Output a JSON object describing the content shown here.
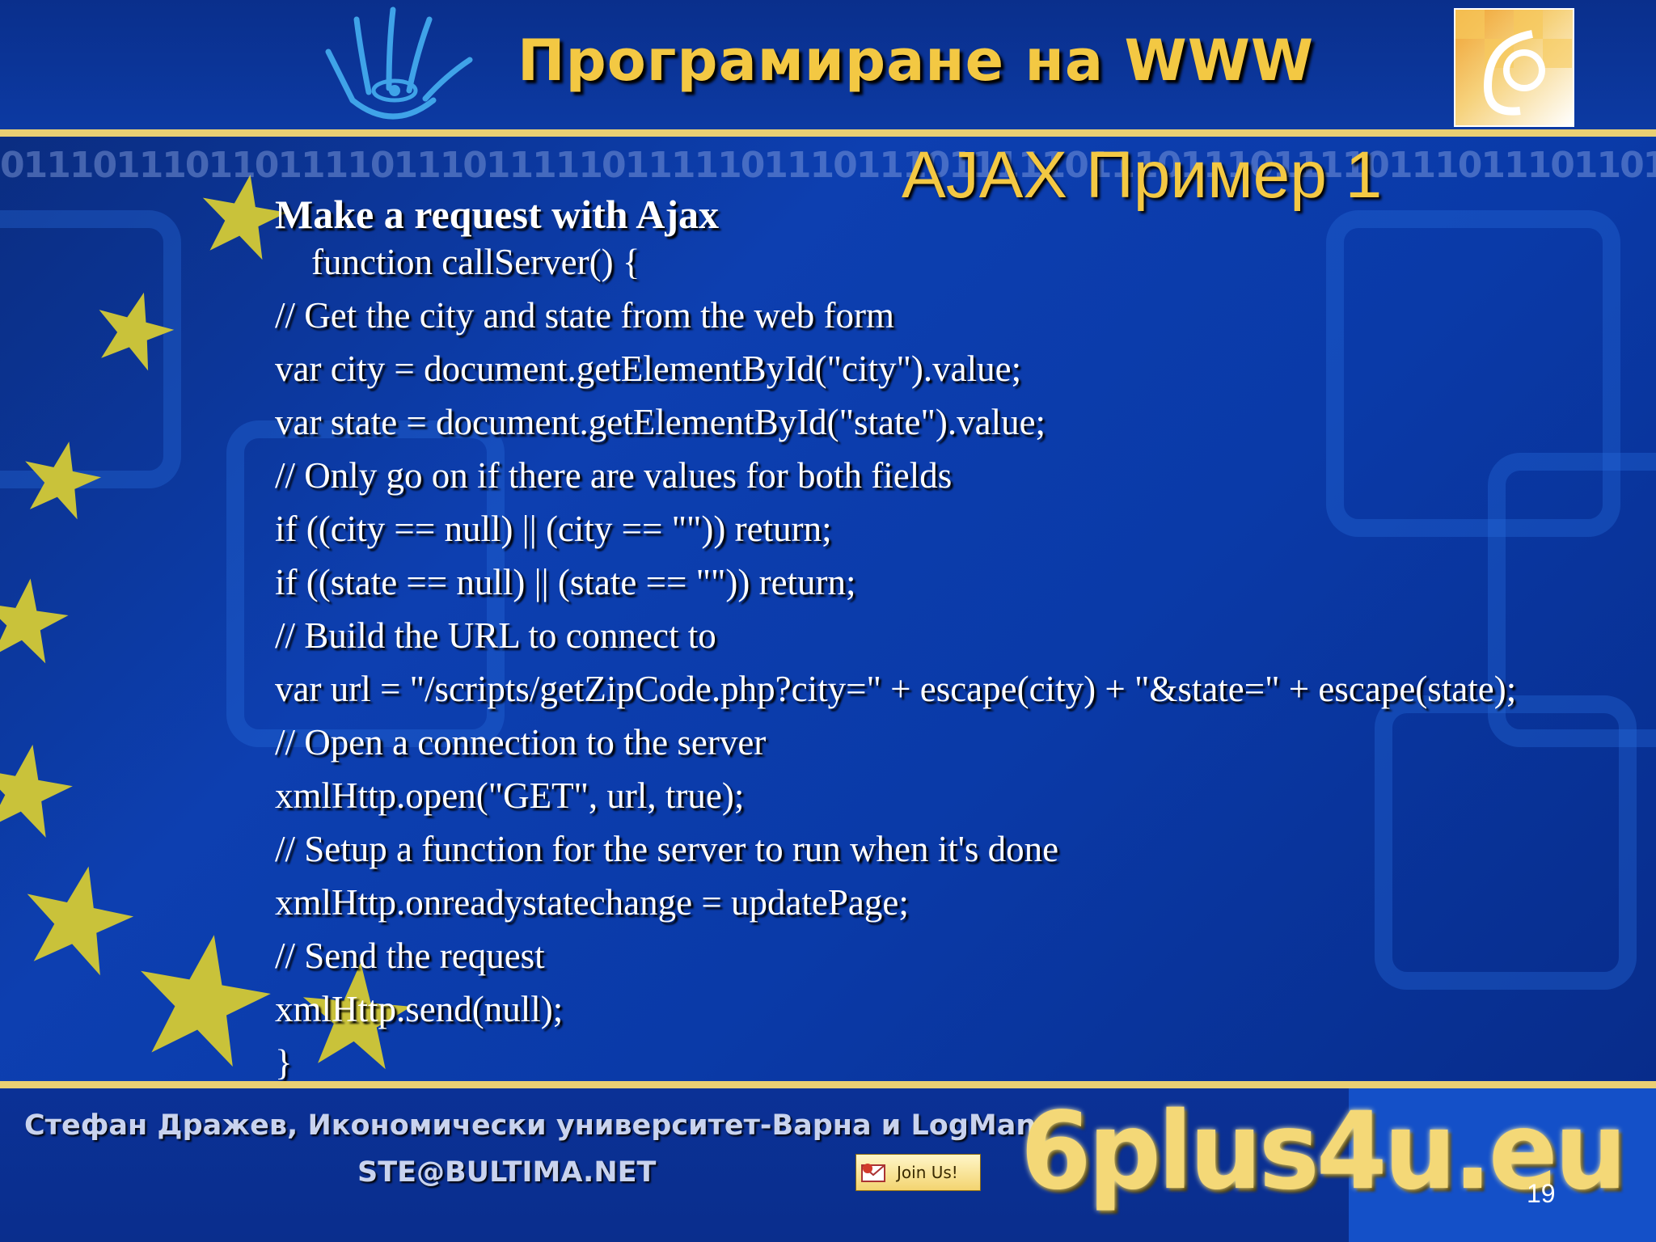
{
  "header": {
    "title": "Програмиране на WWW",
    "subtitle": "AJAX Пример 1",
    "binary_strip": "01110111011011110111011111011111011101110111110111011101111011101110110101110101011"
  },
  "content": {
    "heading": "Make a request with Ajax",
    "code_lines": [
      "    function callServer() {",
      "// Get the city and state from the web form",
      "var city = document.getElementById(\"city\").value;",
      "var state = document.getElementById(\"state\").value;",
      "// Only go on if there are values for both fields",
      "if ((city == null) || (city == \"\")) return;",
      "if ((state == null) || (state == \"\")) return;",
      "// Build the URL to connect to",
      "var url = \"/scripts/getZipCode.php?city=\" + escape(city) + \"&state=\" + escape(state);",
      "// Open a connection to the server",
      "xmlHttp.open(\"GET\", url, true);",
      "// Setup a function for the server to run when it's done",
      "xmlHttp.onreadystatechange = updatePage;",
      "// Send the request",
      "xmlHttp.send(null);",
      "}"
    ]
  },
  "footer": {
    "author": "Стефан  Дражев, Икономически университет-Варна и LogMan",
    "email": "STE@BULTIMA.NET",
    "join_label": "Join Us!",
    "site": "6plus4u.eu",
    "page_number": "19"
  },
  "colors": {
    "accent_gold": "#f3c843",
    "rule_gold": "#e9cf73",
    "background_blue": "#0d3fb0"
  },
  "icons": [
    "hand-eye-icon",
    "sigas-logo",
    "star-icon",
    "join-envelope-icon"
  ]
}
